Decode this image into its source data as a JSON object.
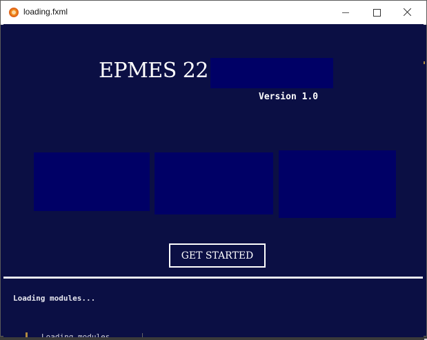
{
  "window": {
    "title": "loading.fxml",
    "app_icon": "app-logo-icon"
  },
  "controls": {
    "minimize_icon": "minimize-icon",
    "maximize_icon": "maximize-icon",
    "close_icon": "close-icon"
  },
  "splash": {
    "app_name": "EPMES 22",
    "version": "Version 1.0",
    "get_started_label": "GET STARTED"
  },
  "loading": {
    "status": "Loading modules...",
    "ghost_status": "Loading modules",
    "progress": 1.0
  },
  "colors": {
    "background": "#0b0f44",
    "panel": "#000066",
    "text": "#ffffff"
  }
}
